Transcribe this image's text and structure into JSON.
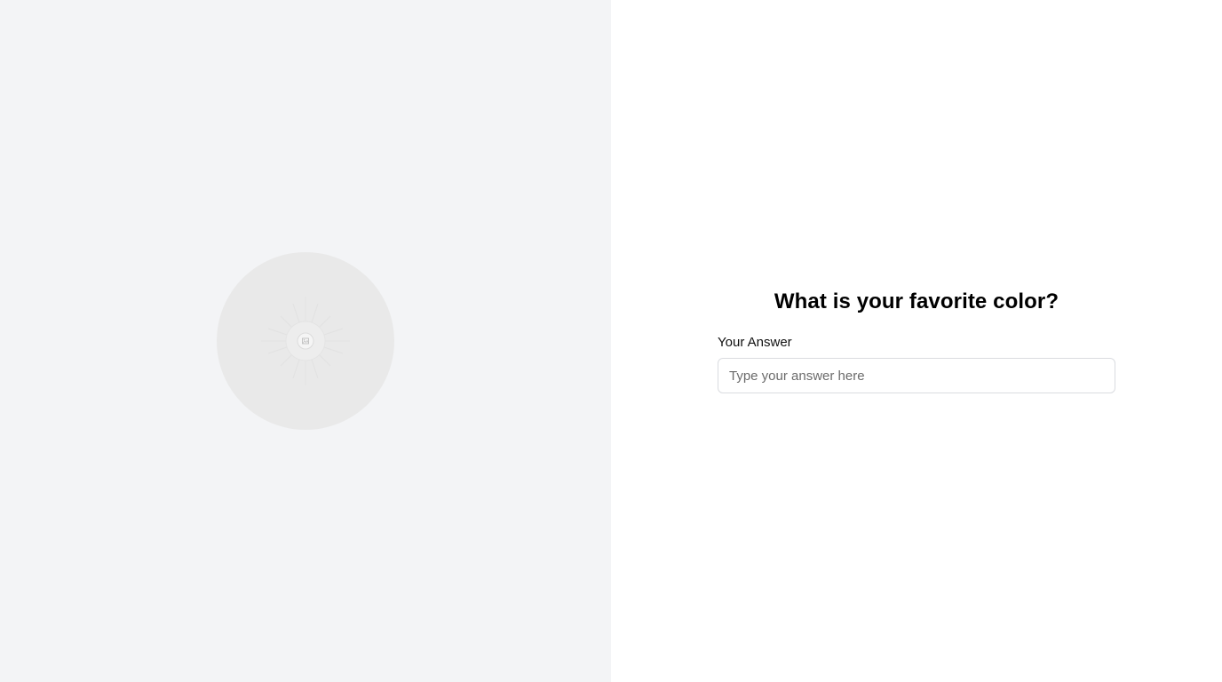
{
  "image_panel": {
    "placeholder_icon": "image-icon",
    "colors": {
      "panel_background": "#f3f4f6",
      "circle_background": "#e9e9e9"
    }
  },
  "question": {
    "title": "What is your favorite color?",
    "answer_label": "Your Answer",
    "answer_value": "",
    "answer_placeholder": "Type your answer here"
  }
}
